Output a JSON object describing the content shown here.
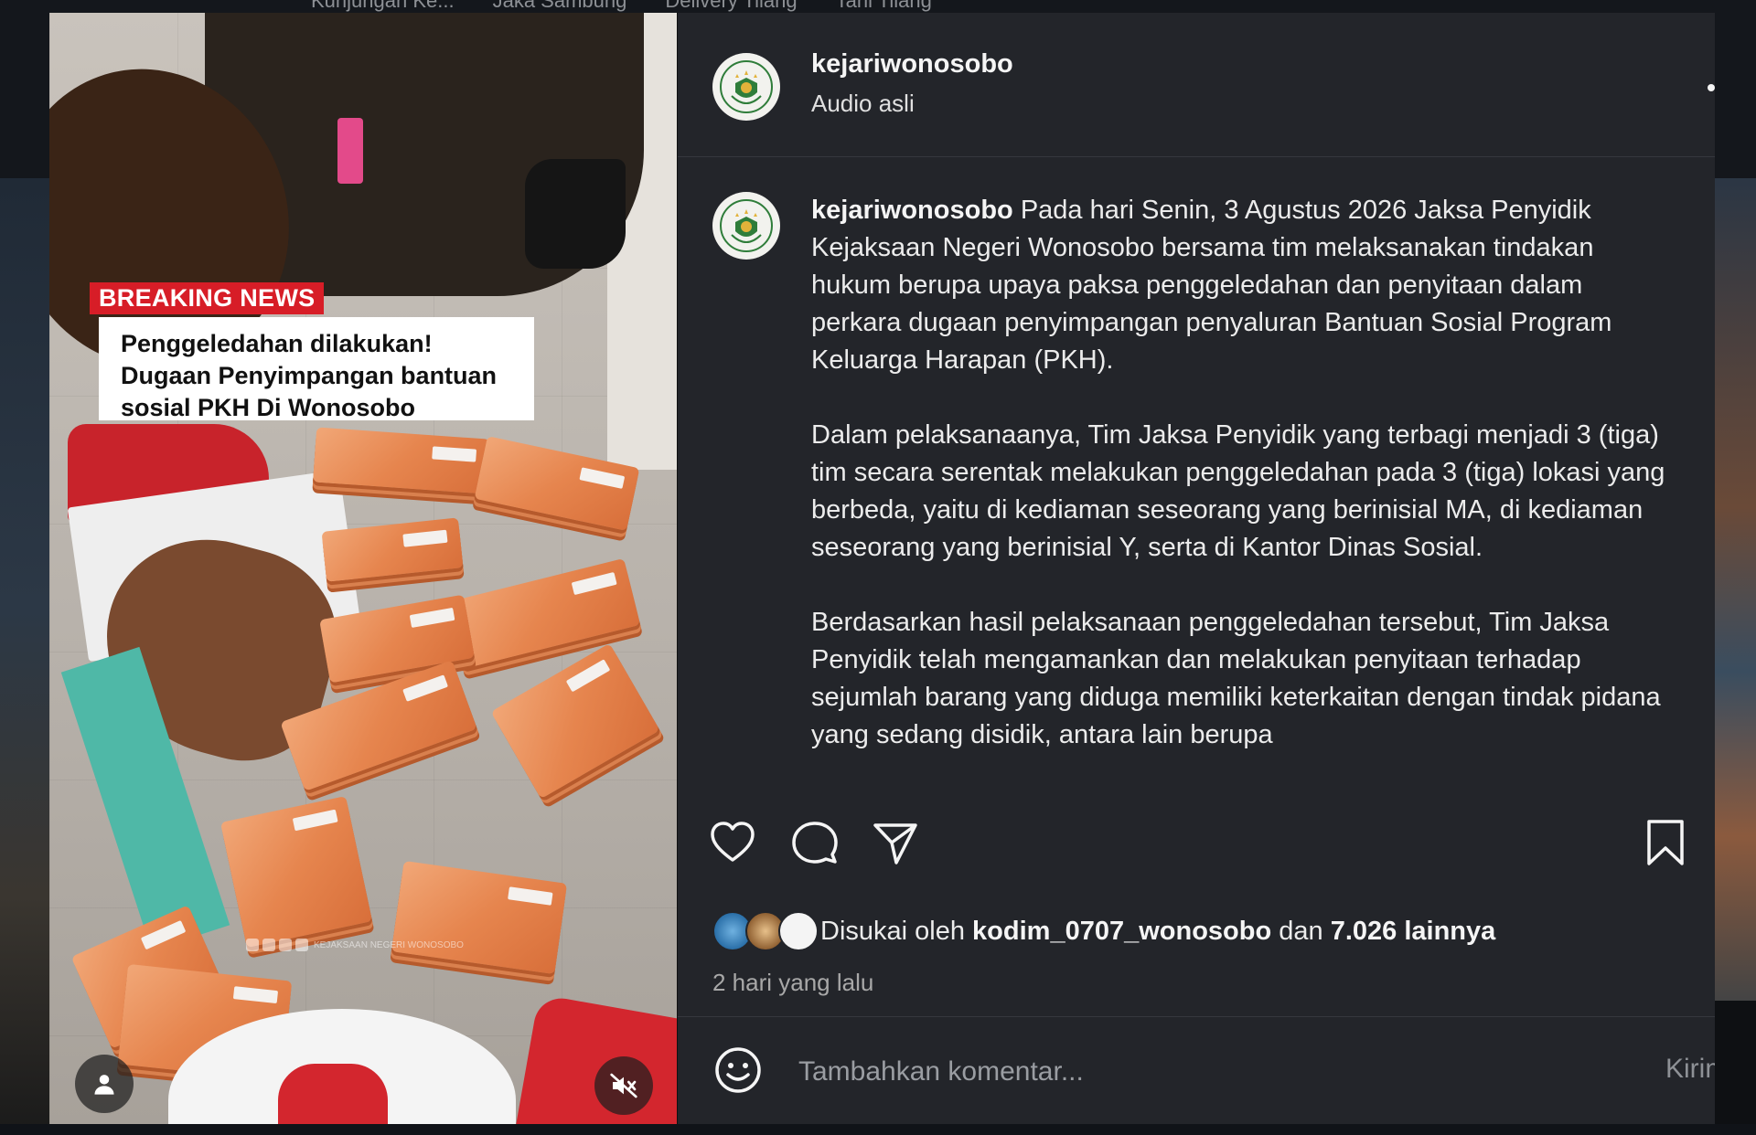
{
  "background_tabs": [
    "Kunjungan Ke...",
    "Jaka Sambung",
    "Delivery Tilang",
    "Tahi Tilang"
  ],
  "media": {
    "breaking_label": "BREAKING NEWS",
    "headline_lines": [
      "Penggeledahan dilakukan!",
      "Dugaan Penyimpangan bantuan",
      "sosial PKH Di Wonosobo"
    ],
    "watermark": "KEJAKSAAN NEGERI WONOSOBO",
    "user_icon": "user-icon",
    "mute_icon": "speaker-muted-icon"
  },
  "post": {
    "username": "kejariwonosobo",
    "audio": "Audio asli",
    "more_icon": "more-options-icon",
    "caption_paragraphs": [
      "Pada hari Senin, 3 Agustus 2026 Jaksa Penyidik Kejaksaan Negeri Wonosobo bersama tim melaksanakan tindakan hukum berupa upaya paksa penggeledahan dan penyitaan dalam perkara dugaan penyimpangan penyaluran Bantuan Sosial Program Keluarga Harapan (PKH).",
      "Dalam pelaksanaanya, Tim Jaksa Penyidik yang terbagi menjadi 3 (tiga) tim secara serentak melakukan penggeledahan pada 3 (tiga) lokasi yang berbeda, yaitu di kediaman seseorang yang berinisial MA, di kediaman seseorang yang berinisial Y, serta di Kantor Dinas Sosial.",
      "Berdasarkan hasil pelaksanaan penggeledahan tersebut, Tim Jaksa Penyidik telah mengamankan dan melakukan penyitaan terhadap sejumlah barang yang diduga memiliki keterkaitan dengan tindak pidana yang sedang disidik, antara lain berupa"
    ],
    "actions": {
      "like_icon": "heart-icon",
      "comment_icon": "comment-icon",
      "share_icon": "send-icon",
      "save_icon": "bookmark-icon"
    },
    "likes": {
      "prefix": "Disukai oleh",
      "user": "kodim_0707_wonosobo",
      "middle": "dan",
      "count": "7.026 lainnya"
    },
    "time": "2 hari yang lalu",
    "comment": {
      "placeholder": "Tambahkan komentar...",
      "send": "Kirim",
      "emoji_icon": "emoji-icon"
    }
  },
  "colors": {
    "panel_bg": "#23252a",
    "breaking_red": "#d71d27",
    "text": "#ececec",
    "muted": "#a8a8a8"
  }
}
